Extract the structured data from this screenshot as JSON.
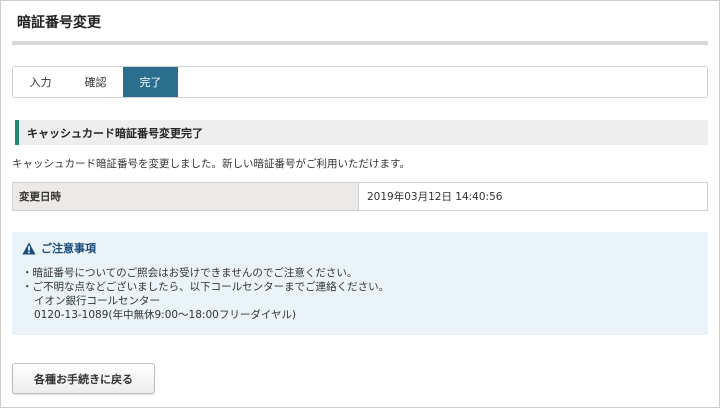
{
  "page": {
    "title": "暗証番号変更"
  },
  "steps": [
    {
      "label": "入力",
      "active": false
    },
    {
      "label": "確認",
      "active": false
    },
    {
      "label": "完了",
      "active": true
    }
  ],
  "section": {
    "heading": "キャッシュカード暗証番号変更完了"
  },
  "message": "キャッシュカード暗証番号を変更しました。新しい暗証番号がご利用いただけます。",
  "info": {
    "label": "変更日時",
    "value": "2019年03月12日 14:40:56"
  },
  "notice": {
    "heading": "ご注意事項",
    "icon": "warning-triangle-icon",
    "lines": [
      "・暗証番号についてのご照会はお受けできませんのでご注意ください。",
      "・ご不明な点などございましたら、以下コールセンターまでご連絡ください。",
      "イオン銀行コールセンター",
      "0120-13-1089(年中無休9:00～18:00フリーダイヤル)"
    ]
  },
  "actions": {
    "back_label": "各種お手続きに戻る"
  },
  "colors": {
    "active_step": "#2b6f8e",
    "section_accent": "#1e8a6e",
    "notice_bg": "#eaf3f8",
    "notice_heading": "#1b4e7a"
  }
}
